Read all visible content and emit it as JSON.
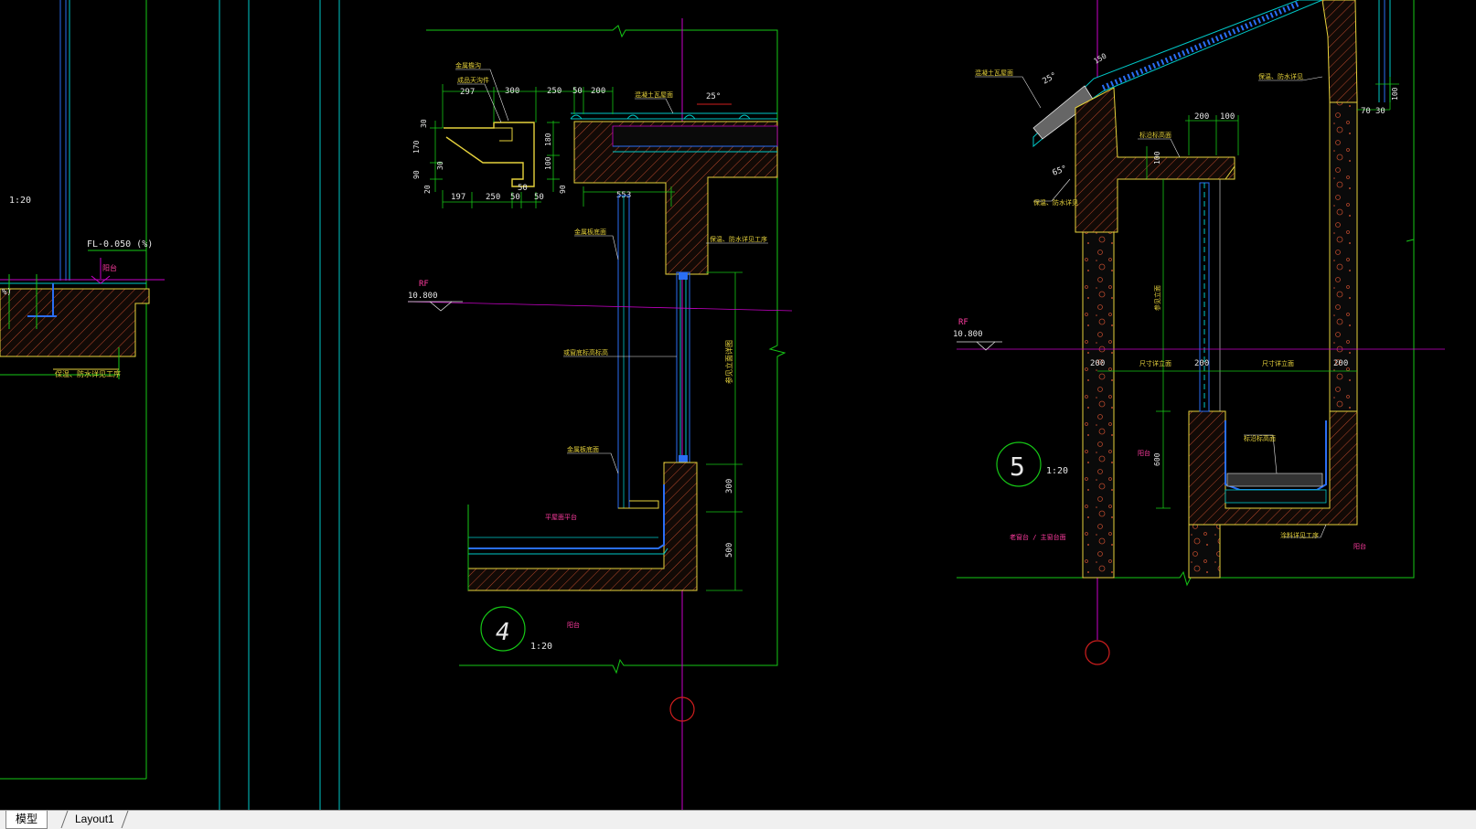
{
  "drawing": {
    "left_detail": {
      "scale": "1:20",
      "level": "FL-0.050 (%)",
      "note_pink": "阳台",
      "note_left": "%)",
      "note_yellow": "保温、防水详见工序"
    },
    "detail4": {
      "number": "4",
      "scale": "1:20",
      "level_tag": "RF",
      "level": "10.800",
      "dims_top": [
        "300",
        "250",
        "50",
        "200"
      ],
      "dims_bottom": [
        "197",
        "250",
        "50",
        "50"
      ],
      "dims_side": [
        "30",
        "170",
        "90",
        "20",
        "30",
        "180",
        "100",
        "90"
      ],
      "dim_297": "297",
      "dim_553": "553",
      "dim_50": "50",
      "dims_right": [
        "300",
        "500"
      ],
      "angle": "25°",
      "labels": {
        "gutter": "金属檐沟",
        "gutter2": "成品天沟件",
        "tile": "混凝土瓦屋面",
        "insul": "保温、防水详见工序",
        "panel": "金属板底面",
        "window": "或窗底标高标高",
        "wall": "金属板底面",
        "vertical": "参见立面详图",
        "pink_ground": "平屋面平台",
        "pink_bottom": "阳台"
      }
    },
    "detail5": {
      "number": "5",
      "scale": "1:20",
      "level_tag": "RF",
      "level": "10.800",
      "dims": [
        "200",
        "100",
        "100",
        "200",
        "200",
        "200",
        "600",
        "70",
        "30",
        "100",
        "150"
      ],
      "angles": [
        "25°",
        "65°"
      ],
      "labels": {
        "roof": "混凝土瓦屋面",
        "insul": "保温、防水详见",
        "insul_left": "保温、防水详见",
        "ledge": "标沿标高面",
        "size_left": "尺寸详立面",
        "size_right": "尺寸详立面",
        "vertical": "参见立面",
        "pink_left": "阳台",
        "pink_note": "老窗台 / 主窗台面",
        "gutter": "标沿标高面",
        "bottom": "涂料详见工序",
        "pink_right": "阳台"
      }
    }
  },
  "colors": {
    "green": "#16c716",
    "cyan": "#00c8c8",
    "blue": "#2a6ef5",
    "magenta": "#c800c8",
    "red": "#d01e1e",
    "yellow": "#e6d23c",
    "white": "#e6e6e6",
    "hatch": "#b4462a"
  },
  "tabs": {
    "model": "模型",
    "layout": "Layout1"
  }
}
